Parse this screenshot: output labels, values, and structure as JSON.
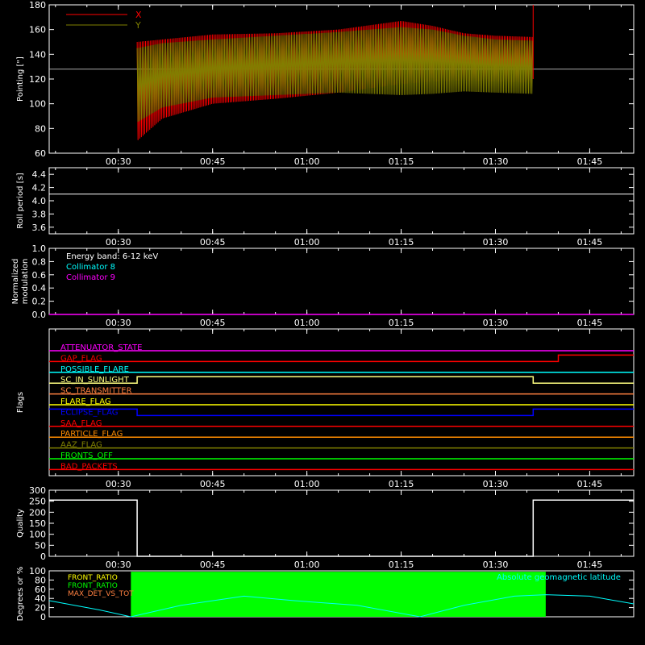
{
  "time_ticks": [
    "00:30",
    "00:45",
    "01:00",
    "01:15",
    "01:30",
    "01:45"
  ],
  "chart_data": [
    {
      "id": "pointing",
      "type": "line",
      "ylabel": "Pointing [\"]",
      "ylim": [
        60,
        180
      ],
      "yticks": [
        "60",
        "80",
        "100",
        "120",
        "140",
        "160",
        "180"
      ],
      "reference_line": 128,
      "legend": {
        "placement": "top-left",
        "entries": [
          {
            "name": "X",
            "color": "#ff0000"
          },
          {
            "name": "Y",
            "color": "#808000"
          }
        ]
      },
      "data_start": "00:33",
      "data_end": "01:36",
      "series": [
        {
          "name": "X",
          "color": "#ff0000",
          "x": [
            "00:33",
            "00:37",
            "00:45",
            "00:55",
            "01:05",
            "01:15",
            "01:20",
            "01:25",
            "01:30",
            "01:36"
          ],
          "upper": [
            150,
            152,
            156,
            157,
            160,
            167,
            163,
            157,
            155,
            154
          ],
          "lower": [
            70,
            88,
            100,
            104,
            109,
            116,
            118,
            119,
            118,
            117
          ]
        },
        {
          "name": "Y",
          "color": "#808000",
          "x": [
            "00:33",
            "00:37",
            "00:45",
            "00:55",
            "01:05",
            "01:15",
            "01:20",
            "01:25",
            "01:30",
            "01:36"
          ],
          "upper": [
            145,
            149,
            152,
            155,
            158,
            162,
            160,
            155,
            152,
            151
          ],
          "lower": [
            85,
            97,
            105,
            107,
            109,
            107,
            108,
            110,
            109,
            108
          ]
        }
      ]
    },
    {
      "id": "roll",
      "type": "line",
      "ylabel": "Roll period [s]",
      "ylim": [
        3.5,
        4.5
      ],
      "yticks": [
        "3.6",
        "3.8",
        "4.0",
        "4.2",
        "4.4"
      ],
      "series": [
        {
          "name": "",
          "color": "#ffffff",
          "value": 4.1
        }
      ]
    },
    {
      "id": "modulation",
      "type": "line",
      "ylabel": "Normalized modulation",
      "ylim": [
        0,
        1
      ],
      "yticks": [
        "0.0",
        "0.2",
        "0.4",
        "0.6",
        "0.8",
        "1.0"
      ],
      "legend": {
        "placement": "top-left",
        "entries": [
          {
            "name": "Energy band: 6-12 keV",
            "color": "#ffffff"
          },
          {
            "name": "Collimator 8",
            "color": "#00ffff"
          },
          {
            "name": "Collimator 9",
            "color": "#ff00ff"
          }
        ]
      },
      "series": [
        {
          "name": "Collimator 9",
          "color": "#ff00ff",
          "value": 0
        }
      ]
    },
    {
      "id": "flags",
      "type": "line",
      "ylabel": "Flags",
      "flags": [
        {
          "name": "ATTENUATOR_STATE",
          "color": "#ff00ff",
          "segments": [
            {
              "from": "00:19",
              "to": "01:52",
              "level": 0
            }
          ]
        },
        {
          "name": "GAP_FLAG",
          "color": "#ff0000",
          "segments": [
            {
              "from": "00:19",
              "to": "01:40",
              "level": 0
            },
            {
              "from": "01:40",
              "to": "01:52",
              "level": 1
            }
          ]
        },
        {
          "name": "POSSIBLE_FLARE",
          "color": "#00ffff",
          "segments": [
            {
              "from": "00:19",
              "to": "01:52",
              "level": 0
            }
          ]
        },
        {
          "name": "SC_IN_SUNLIGHT",
          "color": "#ffff80",
          "segments": [
            {
              "from": "00:19",
              "to": "00:33",
              "level": 0
            },
            {
              "from": "00:33",
              "to": "01:36",
              "level": 1
            },
            {
              "from": "01:36",
              "to": "01:52",
              "level": 0
            }
          ]
        },
        {
          "name": "SC_TRANSMITTER",
          "color": "#ff8040",
          "segments": [
            {
              "from": "00:19",
              "to": "01:52",
              "level": 0
            }
          ]
        },
        {
          "name": "FLARE_FLAG",
          "color": "#ffff00",
          "segments": [
            {
              "from": "00:19",
              "to": "01:52",
              "level": 0
            }
          ]
        },
        {
          "name": "ECLIPSE_FLAG",
          "color": "#0000ff",
          "segments": [
            {
              "from": "00:19",
              "to": "00:33",
              "level": 1
            },
            {
              "from": "00:33",
              "to": "01:36",
              "level": 0
            },
            {
              "from": "01:36",
              "to": "01:52",
              "level": 1
            }
          ]
        },
        {
          "name": "SAA_FLAG",
          "color": "#ff0000",
          "segments": [
            {
              "from": "00:19",
              "to": "01:52",
              "level": 0
            }
          ]
        },
        {
          "name": "PARTICLE_FLAG",
          "color": "#ff8c00",
          "segments": [
            {
              "from": "00:19",
              "to": "01:52",
              "level": 0
            }
          ]
        },
        {
          "name": "AAZ_FLAG",
          "color": "#808000",
          "segments": [
            {
              "from": "00:19",
              "to": "01:52",
              "level": 0
            }
          ]
        },
        {
          "name": "FRONTS_OFF",
          "color": "#00ff00",
          "segments": [
            {
              "from": "00:19",
              "to": "01:52",
              "level": 0
            }
          ]
        },
        {
          "name": "BAD_PACKETS",
          "color": "#ff0000",
          "segments": [
            {
              "from": "00:19",
              "to": "01:52",
              "level": 0
            }
          ]
        }
      ]
    },
    {
      "id": "quality",
      "type": "line",
      "ylabel": "Quality",
      "ylim": [
        0,
        300
      ],
      "yticks": [
        "0",
        "50",
        "100",
        "150",
        "200",
        "250",
        "300"
      ],
      "series": [
        {
          "name": "",
          "color": "#ffffff",
          "x": [
            "00:19",
            "00:33",
            "00:33",
            "01:36",
            "01:36",
            "01:52"
          ],
          "y": [
            255,
            255,
            0,
            0,
            255,
            255
          ]
        }
      ]
    },
    {
      "id": "status",
      "type": "line",
      "ylabel": "Degrees or %",
      "ylim": [
        0,
        100
      ],
      "yticks": [
        "0",
        "20",
        "40",
        "60",
        "80",
        "100"
      ],
      "legend": {
        "placement": "top",
        "entries": [
          {
            "name": "FRONT_RATIO",
            "color": "#ffff00"
          },
          {
            "name": "FRONT_RATIO",
            "color": "#00ff00"
          },
          {
            "name": "MAX_DET_VS_TOT",
            "color": "#ff8040"
          },
          {
            "name": "Absolute geomagnetic latitude",
            "color": "#00ffff"
          }
        ]
      },
      "series": [
        {
          "name": "Absolute geomagnetic latitude",
          "color": "#00ffff",
          "x": [
            "00:19",
            "00:27",
            "00:32",
            "00:40",
            "00:50",
            "00:58",
            "01:08",
            "01:18",
            "01:25",
            "01:33",
            "01:38",
            "01:45",
            "01:52"
          ],
          "y": [
            35,
            15,
            0,
            25,
            45,
            35,
            25,
            0,
            25,
            45,
            48,
            45,
            28
          ]
        },
        {
          "name": "FRONT_RATIO",
          "color": "#00ff00",
          "range": [
            "00:32",
            "01:38"
          ],
          "level": 98
        }
      ]
    }
  ]
}
